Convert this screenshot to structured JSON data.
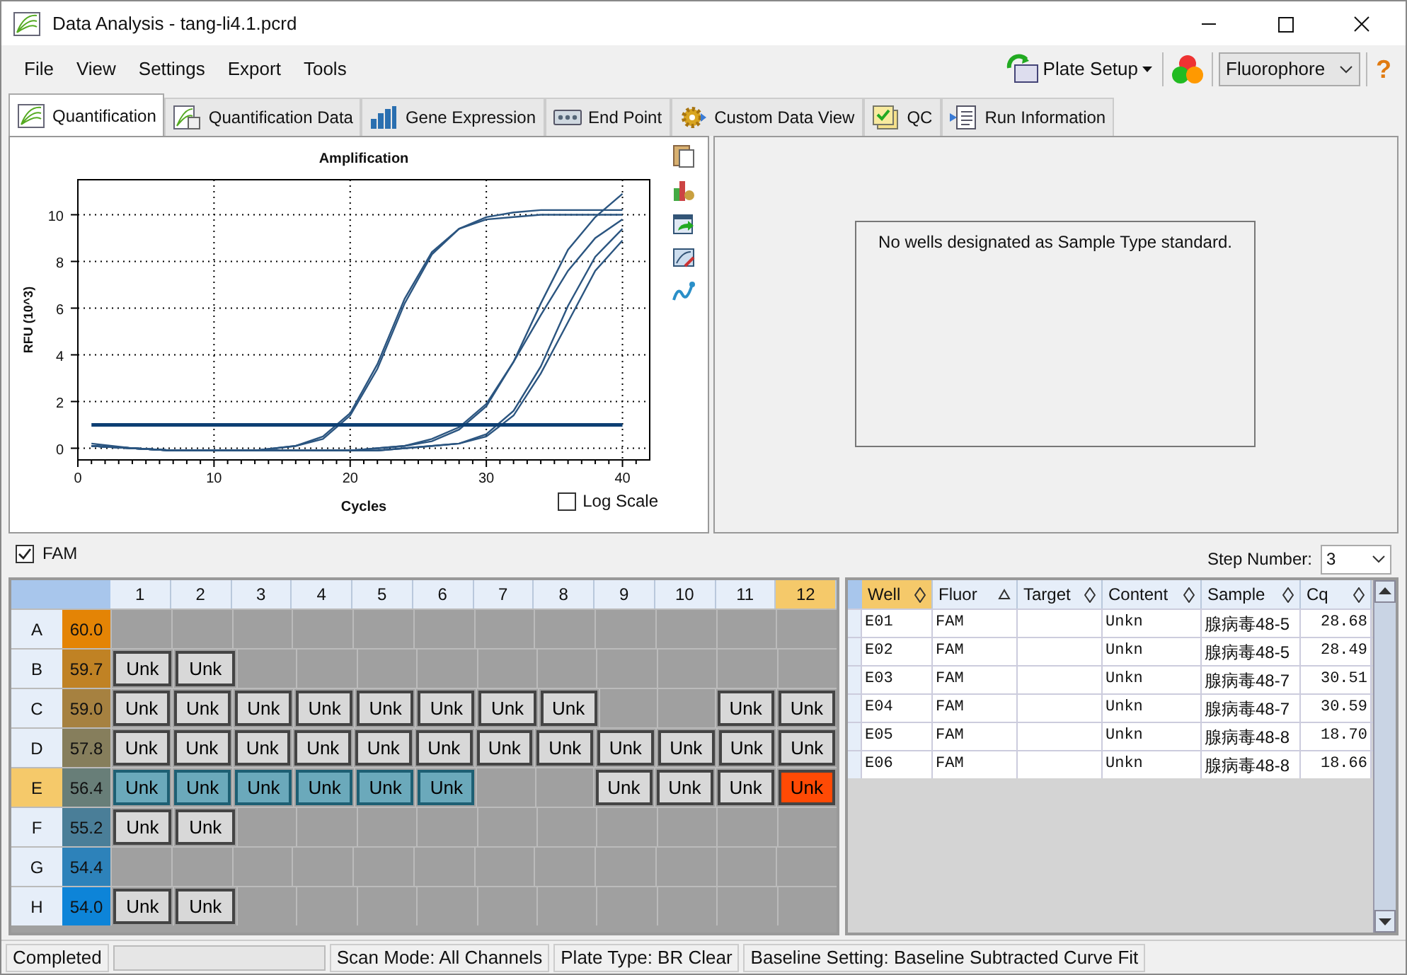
{
  "window": {
    "title": "Data Analysis - tang-li4.1.pcrd"
  },
  "menu": [
    "File",
    "View",
    "Settings",
    "Export",
    "Tools"
  ],
  "toolbar": {
    "plate_setup": "Plate Setup",
    "fluorophore": "Fluorophore",
    "help": "?"
  },
  "tabs": [
    {
      "label": "Quantification",
      "selected": true,
      "kind": "curve"
    },
    {
      "label": "Quantification Data",
      "selected": false,
      "kind": "curvedoc"
    },
    {
      "label": "Gene Expression",
      "selected": false,
      "kind": "bars"
    },
    {
      "label": "End Point",
      "selected": false,
      "kind": "device"
    },
    {
      "label": "Custom Data View",
      "selected": false,
      "kind": "gear"
    },
    {
      "label": "QC",
      "selected": false,
      "kind": "check"
    },
    {
      "label": "Run Information",
      "selected": false,
      "kind": "doc"
    }
  ],
  "amplification": {
    "log_scale": {
      "label": "Log Scale",
      "checked": false
    },
    "chart_data": {
      "type": "line",
      "title": "Amplification",
      "xlabel": "Cycles",
      "ylabel": "RFU (10^3)",
      "grid": true,
      "x": [
        1,
        4,
        7,
        10,
        13,
        16,
        18,
        20,
        22,
        24,
        26,
        28,
        30,
        32,
        34,
        36,
        38,
        40
      ],
      "xlim": [
        0,
        42
      ],
      "ylim": [
        -0.5,
        11.5
      ],
      "xticks": [
        0,
        10,
        20,
        30,
        40
      ],
      "yticks": [
        0,
        2,
        4,
        6,
        8,
        10
      ],
      "series": [
        {
          "color": "#2b5580",
          "values": [
            0.2,
            0,
            -0.1,
            -0.1,
            -0.1,
            0.1,
            0.5,
            1.5,
            3.6,
            6.4,
            8.4,
            9.4,
            9.8,
            9.9,
            10,
            10,
            10,
            10
          ]
        },
        {
          "color": "#2b5580",
          "values": [
            0.1,
            0,
            -0.1,
            -0.1,
            -0.1,
            0.1,
            0.4,
            1.4,
            3.4,
            6.2,
            8.3,
            9.4,
            9.9,
            10.1,
            10.2,
            10.2,
            10.2,
            10.2
          ]
        },
        {
          "color": "#2b5580",
          "values": [
            0.1,
            0,
            -0.1,
            -0.1,
            -0.1,
            -0.1,
            -0.1,
            -0.1,
            0,
            0.1,
            0.3,
            0.8,
            1.8,
            3.7,
            6.2,
            8.5,
            9.9,
            10.9
          ]
        },
        {
          "color": "#2b5580",
          "values": [
            0.1,
            0,
            -0.1,
            -0.1,
            -0.1,
            -0.1,
            -0.1,
            -0.1,
            0,
            0.1,
            0.4,
            0.9,
            1.9,
            3.7,
            5.7,
            7.6,
            9,
            9.8
          ]
        },
        {
          "color": "#2b5580",
          "values": [
            0.1,
            0,
            -0.1,
            -0.1,
            -0.1,
            -0.1,
            -0.1,
            -0.1,
            -0.1,
            0,
            0.1,
            0.2,
            0.6,
            1.6,
            3.5,
            6.1,
            8.2,
            9.4
          ]
        },
        {
          "color": "#2b5580",
          "values": [
            0.1,
            0,
            -0.1,
            -0.1,
            -0.1,
            -0.1,
            -0.1,
            -0.1,
            -0.1,
            0,
            0.1,
            0.2,
            0.5,
            1.4,
            3.2,
            5.4,
            7.6,
            8.9
          ]
        },
        {
          "color": "#0d3f73",
          "values": [
            1,
            1,
            1,
            1,
            1,
            1,
            1,
            1,
            1,
            1,
            1,
            1,
            1,
            1,
            1,
            1,
            1,
            1
          ]
        }
      ]
    }
  },
  "standard_curve": {
    "message": "No wells designated as Sample Type standard."
  },
  "fluor_filter": {
    "label": "FAM",
    "checked": true
  },
  "step": {
    "label": "Step Number:",
    "value": "3"
  },
  "plate": {
    "columns": [
      {
        "label": "1",
        "selected": false
      },
      {
        "label": "2",
        "selected": false
      },
      {
        "label": "3",
        "selected": false
      },
      {
        "label": "4",
        "selected": false
      },
      {
        "label": "5",
        "selected": false
      },
      {
        "label": "6",
        "selected": false
      },
      {
        "label": "7",
        "selected": false
      },
      {
        "label": "8",
        "selected": false
      },
      {
        "label": "9",
        "selected": false
      },
      {
        "label": "10",
        "selected": false
      },
      {
        "label": "11",
        "selected": false
      },
      {
        "label": "12",
        "selected": true
      }
    ],
    "rows": [
      {
        "label": "A",
        "selected": false,
        "temp": "60.0",
        "color": "#e48405",
        "wells": [
          {
            "kind": "empty"
          },
          {
            "kind": "empty"
          },
          {
            "kind": "empty"
          },
          {
            "kind": "empty"
          },
          {
            "kind": "empty"
          },
          {
            "kind": "empty"
          },
          {
            "kind": "empty"
          },
          {
            "kind": "empty"
          },
          {
            "kind": "empty"
          },
          {
            "kind": "empty"
          },
          {
            "kind": "empty"
          },
          {
            "kind": "empty"
          }
        ]
      },
      {
        "label": "B",
        "selected": false,
        "temp": "59.7",
        "color": "#c08224",
        "wells": [
          {
            "kind": "sample",
            "label": "Unk",
            "selected": false,
            "focused": false
          },
          {
            "kind": "sample",
            "label": "Unk",
            "selected": false,
            "focused": false
          },
          {
            "kind": "empty"
          },
          {
            "kind": "empty"
          },
          {
            "kind": "empty"
          },
          {
            "kind": "empty"
          },
          {
            "kind": "empty"
          },
          {
            "kind": "empty"
          },
          {
            "kind": "empty"
          },
          {
            "kind": "empty"
          },
          {
            "kind": "empty"
          },
          {
            "kind": "empty"
          }
        ]
      },
      {
        "label": "C",
        "selected": false,
        "temp": "59.0",
        "color": "#a68140",
        "wells": [
          {
            "kind": "sample",
            "label": "Unk",
            "selected": false,
            "focused": false
          },
          {
            "kind": "sample",
            "label": "Unk",
            "selected": false,
            "focused": false
          },
          {
            "kind": "sample",
            "label": "Unk",
            "selected": false,
            "focused": false
          },
          {
            "kind": "sample",
            "label": "Unk",
            "selected": false,
            "focused": false
          },
          {
            "kind": "sample",
            "label": "Unk",
            "selected": false,
            "focused": false
          },
          {
            "kind": "sample",
            "label": "Unk",
            "selected": false,
            "focused": false
          },
          {
            "kind": "sample",
            "label": "Unk",
            "selected": false,
            "focused": false
          },
          {
            "kind": "sample",
            "label": "Unk",
            "selected": false,
            "focused": false
          },
          {
            "kind": "empty"
          },
          {
            "kind": "empty"
          },
          {
            "kind": "sample",
            "label": "Unk",
            "selected": false,
            "focused": false
          },
          {
            "kind": "sample",
            "label": "Unk",
            "selected": false,
            "focused": false
          }
        ]
      },
      {
        "label": "D",
        "selected": false,
        "temp": "57.8",
        "color": "#867e5c",
        "wells": [
          {
            "kind": "sample",
            "label": "Unk",
            "selected": false,
            "focused": false
          },
          {
            "kind": "sample",
            "label": "Unk",
            "selected": false,
            "focused": false
          },
          {
            "kind": "sample",
            "label": "Unk",
            "selected": false,
            "focused": false
          },
          {
            "kind": "sample",
            "label": "Unk",
            "selected": false,
            "focused": false
          },
          {
            "kind": "sample",
            "label": "Unk",
            "selected": false,
            "focused": false
          },
          {
            "kind": "sample",
            "label": "Unk",
            "selected": false,
            "focused": false
          },
          {
            "kind": "sample",
            "label": "Unk",
            "selected": false,
            "focused": false
          },
          {
            "kind": "sample",
            "label": "Unk",
            "selected": false,
            "focused": false
          },
          {
            "kind": "sample",
            "label": "Unk",
            "selected": false,
            "focused": false
          },
          {
            "kind": "sample",
            "label": "Unk",
            "selected": false,
            "focused": false
          },
          {
            "kind": "sample",
            "label": "Unk",
            "selected": false,
            "focused": false
          },
          {
            "kind": "sample",
            "label": "Unk",
            "selected": false,
            "focused": false
          }
        ]
      },
      {
        "label": "E",
        "selected": true,
        "temp": "56.4",
        "color": "#687e78",
        "wells": [
          {
            "kind": "sample",
            "label": "Unk",
            "selected": true,
            "focused": false
          },
          {
            "kind": "sample",
            "label": "Unk",
            "selected": true,
            "focused": false
          },
          {
            "kind": "sample",
            "label": "Unk",
            "selected": true,
            "focused": false
          },
          {
            "kind": "sample",
            "label": "Unk",
            "selected": true,
            "focused": false
          },
          {
            "kind": "sample",
            "label": "Unk",
            "selected": true,
            "focused": false
          },
          {
            "kind": "sample",
            "label": "Unk",
            "selected": true,
            "focused": false
          },
          {
            "kind": "empty"
          },
          {
            "kind": "empty"
          },
          {
            "kind": "sample",
            "label": "Unk",
            "selected": false,
            "focused": false
          },
          {
            "kind": "sample",
            "label": "Unk",
            "selected": false,
            "focused": false
          },
          {
            "kind": "sample",
            "label": "Unk",
            "selected": false,
            "focused": false
          },
          {
            "kind": "sample",
            "label": "Unk",
            "selected": false,
            "focused": true
          }
        ]
      },
      {
        "label": "F",
        "selected": false,
        "temp": "55.2",
        "color": "#4a7e98",
        "wells": [
          {
            "kind": "sample",
            "label": "Unk",
            "selected": false,
            "focused": false
          },
          {
            "kind": "sample",
            "label": "Unk",
            "selected": false,
            "focused": false
          },
          {
            "kind": "empty"
          },
          {
            "kind": "empty"
          },
          {
            "kind": "empty"
          },
          {
            "kind": "empty"
          },
          {
            "kind": "empty"
          },
          {
            "kind": "empty"
          },
          {
            "kind": "empty"
          },
          {
            "kind": "empty"
          },
          {
            "kind": "empty"
          },
          {
            "kind": "empty"
          }
        ]
      },
      {
        "label": "G",
        "selected": false,
        "temp": "54.4",
        "color": "#2d82ba",
        "wells": [
          {
            "kind": "empty"
          },
          {
            "kind": "empty"
          },
          {
            "kind": "empty"
          },
          {
            "kind": "empty"
          },
          {
            "kind": "empty"
          },
          {
            "kind": "empty"
          },
          {
            "kind": "empty"
          },
          {
            "kind": "empty"
          },
          {
            "kind": "empty"
          },
          {
            "kind": "empty"
          },
          {
            "kind": "empty"
          },
          {
            "kind": "empty"
          }
        ]
      },
      {
        "label": "H",
        "selected": false,
        "temp": "54.0",
        "color": "#0d84d8",
        "wells": [
          {
            "kind": "sample",
            "label": "Unk",
            "selected": false,
            "focused": false
          },
          {
            "kind": "sample",
            "label": "Unk",
            "selected": false,
            "focused": false
          },
          {
            "kind": "empty"
          },
          {
            "kind": "empty"
          },
          {
            "kind": "empty"
          },
          {
            "kind": "empty"
          },
          {
            "kind": "empty"
          },
          {
            "kind": "empty"
          },
          {
            "kind": "empty"
          },
          {
            "kind": "empty"
          },
          {
            "kind": "empty"
          },
          {
            "kind": "empty"
          }
        ]
      }
    ]
  },
  "results": {
    "columns": [
      {
        "label": "Well",
        "kind": "unsorted",
        "selected": true
      },
      {
        "label": "Fluor",
        "kind": "ascending",
        "selected": false
      },
      {
        "label": "Target",
        "kind": "unsorted",
        "selected": false
      },
      {
        "label": "Content",
        "kind": "unsorted",
        "selected": false
      },
      {
        "label": "Sample",
        "kind": "unsorted",
        "selected": false
      },
      {
        "label": "Cq",
        "kind": "unsorted",
        "selected": false
      }
    ],
    "rows": [
      {
        "well": "E01",
        "fluor": "FAM",
        "content": "Unkn",
        "sample": "腺病毒48-5",
        "cq": "28.68"
      },
      {
        "well": "E02",
        "fluor": "FAM",
        "content": "Unkn",
        "sample": "腺病毒48-5",
        "cq": "28.49"
      },
      {
        "well": "E03",
        "fluor": "FAM",
        "content": "Unkn",
        "sample": "腺病毒48-7",
        "cq": "30.51"
      },
      {
        "well": "E04",
        "fluor": "FAM",
        "content": "Unkn",
        "sample": "腺病毒48-7",
        "cq": "30.59"
      },
      {
        "well": "E05",
        "fluor": "FAM",
        "content": "Unkn",
        "sample": "腺病毒48-8",
        "cq": "18.70"
      },
      {
        "well": "E06",
        "fluor": "FAM",
        "content": "Unkn",
        "sample": "腺病毒48-8",
        "cq": "18.66"
      }
    ]
  },
  "status_bar": {
    "state": "Completed",
    "progress": {
      "level": 0
    },
    "scan_mode": "Scan Mode: All Channels",
    "plate_type": "Plate Type: BR Clear",
    "baseline": "Baseline Setting: Baseline Subtracted Curve Fit"
  }
}
